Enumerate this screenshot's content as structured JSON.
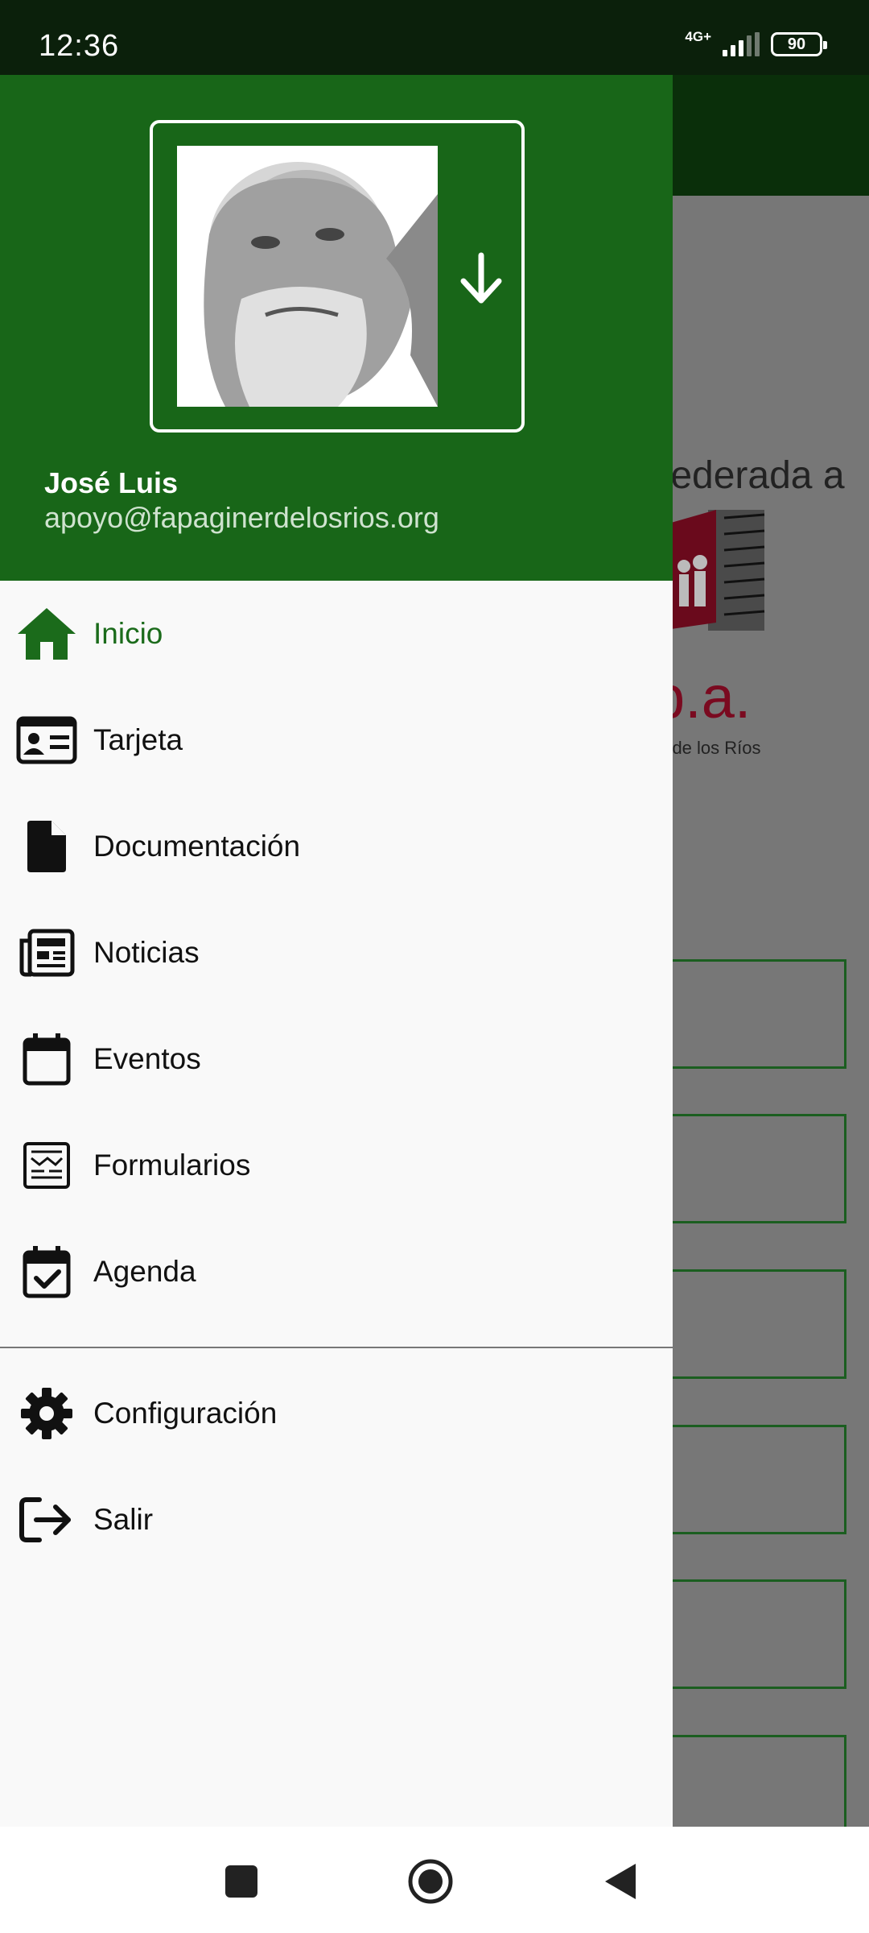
{
  "status_bar": {
    "time": "12:36",
    "network": "4G+",
    "battery": "90"
  },
  "drawer": {
    "user_name": "José Luis",
    "user_email": "apoyo@fapaginerdelosrios.org",
    "items": [
      {
        "label": "Inicio",
        "icon": "home-icon",
        "active": true
      },
      {
        "label": "Tarjeta",
        "icon": "id-card-icon"
      },
      {
        "label": "Documentación",
        "icon": "file-icon"
      },
      {
        "label": "Noticias",
        "icon": "newspaper-icon"
      },
      {
        "label": "Eventos",
        "icon": "calendar-icon"
      },
      {
        "label": "Formularios",
        "icon": "form-icon"
      },
      {
        "label": "Agenda",
        "icon": "calendar-check-icon"
      }
    ],
    "secondary_items": [
      {
        "label": "Configuración",
        "icon": "gear-icon"
      },
      {
        "label": "Salir",
        "icon": "logout-icon"
      }
    ]
  },
  "background": {
    "text": "federada a",
    "logo_text": "p.a.",
    "logo_sub": "r de los Ríos"
  },
  "colors": {
    "primary": "#186618",
    "accent": "#1b6b1b",
    "status_bar": "#0b200b"
  }
}
